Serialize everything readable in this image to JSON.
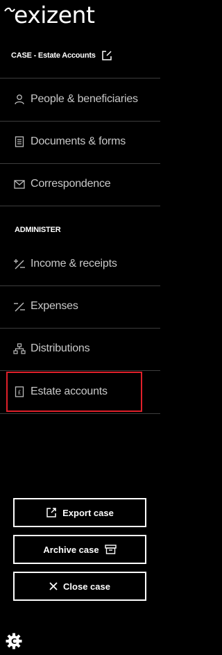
{
  "brand": {
    "logo_text": "exizent"
  },
  "case": {
    "title": "CASE - Estate Accounts",
    "edit_icon": "edit-icon"
  },
  "nav": {
    "items": [
      {
        "label": "People & beneficiaries",
        "icon": "person-icon"
      },
      {
        "label": "Documents & forms",
        "icon": "document-icon"
      },
      {
        "label": "Correspondence",
        "icon": "mail-icon"
      }
    ]
  },
  "administer": {
    "heading": "ADMINISTER",
    "items": [
      {
        "label": "Income & receipts",
        "icon": "income-icon"
      },
      {
        "label": "Expenses",
        "icon": "expenses-icon"
      },
      {
        "label": "Distributions",
        "icon": "distributions-icon"
      },
      {
        "label": "Estate accounts",
        "icon": "estate-accounts-icon",
        "selected": true
      }
    ]
  },
  "actions": {
    "export_label": "Export case",
    "archive_label": "Archive case",
    "close_label": "Close case"
  },
  "colors": {
    "background": "#000000",
    "text": "#ffffff",
    "muted_text": "#c9c9c9",
    "divider": "#3d3d3d",
    "highlight": "#e0202a"
  }
}
